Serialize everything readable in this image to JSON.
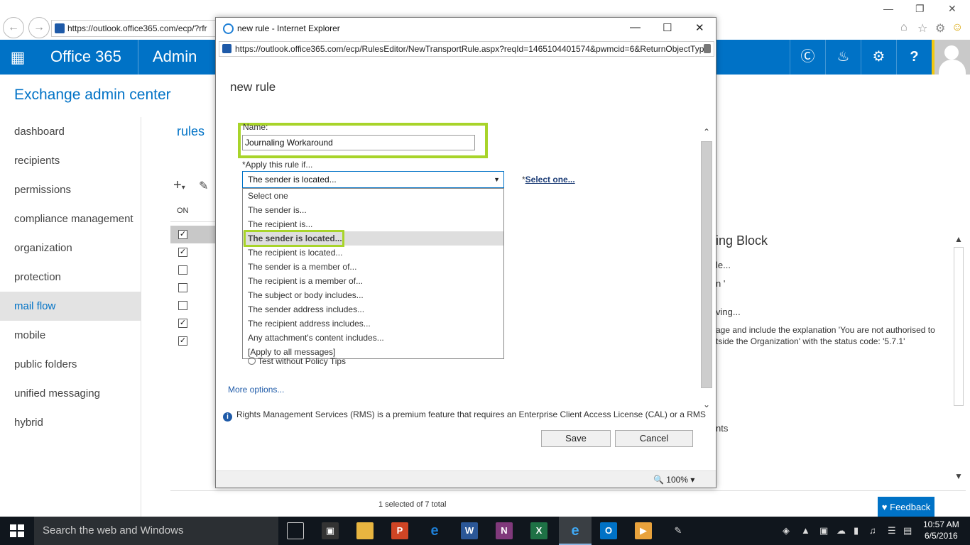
{
  "browser": {
    "bg_url": "https://outlook.office365.com/ecp/?rfr",
    "back_icon": "back-arrow-icon",
    "forward_icon": "forward-arrow-icon"
  },
  "o365": {
    "brand": "Office 365",
    "app": "Admin",
    "accent_color": "#0072c6"
  },
  "eac": {
    "title": "Exchange admin center",
    "nav": [
      "dashboard",
      "recipients",
      "permissions",
      "compliance management",
      "organization",
      "protection",
      "mail flow",
      "mobile",
      "public folders",
      "unified messaging",
      "hybrid"
    ],
    "active_nav": "mail flow"
  },
  "rules": {
    "title": "rules",
    "col_on": "ON",
    "footer": "1 selected of 7 total"
  },
  "details": {
    "title": "ing Block",
    "line1": "le...",
    "line2": "n '",
    "line3": "ving...",
    "line4": "age and include the explanation 'You are not authorised to",
    "line5": "tside the Organization' with the status code: '5.7.1'",
    "line6": "nts"
  },
  "dialog": {
    "window_title": "new rule - Internet Explorer",
    "url": "https://outlook.office365.com/ecp/RulesEditor/NewTransportRule.aspx?reqId=1465104401574&pwmcid=6&ReturnObjectTyp",
    "heading": "new rule",
    "name_label": "Name:",
    "name_value": "Journaling Workaround",
    "apply_label": "*Apply this rule if...",
    "combo_value": "The sender is located...",
    "select_one_prefix": "*",
    "select_one": "Select one...",
    "dropdown_options": [
      "Select one",
      "The sender is...",
      "The recipient is...",
      "The sender is located...",
      "The recipient is located...",
      "The sender is a member of...",
      "The recipient is a member of...",
      "The subject or body includes...",
      "The sender address includes...",
      "The recipient address includes...",
      "Any attachment's content includes...",
      "[Apply to all messages]"
    ],
    "highlighted_option": "The sender is located...",
    "test_option": "Test without Policy Tips",
    "more_options": "More options...",
    "rms_note": "Rights Management Services (RMS) is a premium feature that requires an Enterprise Client Access License (CAL) or a RMS",
    "save": "Save",
    "cancel": "Cancel",
    "zoom": "100%",
    "highlight_color": "#a8d42a"
  },
  "feedback": "Feedback",
  "taskbar": {
    "search_placeholder": "Search the web and Windows",
    "time": "10:57 AM",
    "date": "6/5/2016"
  }
}
